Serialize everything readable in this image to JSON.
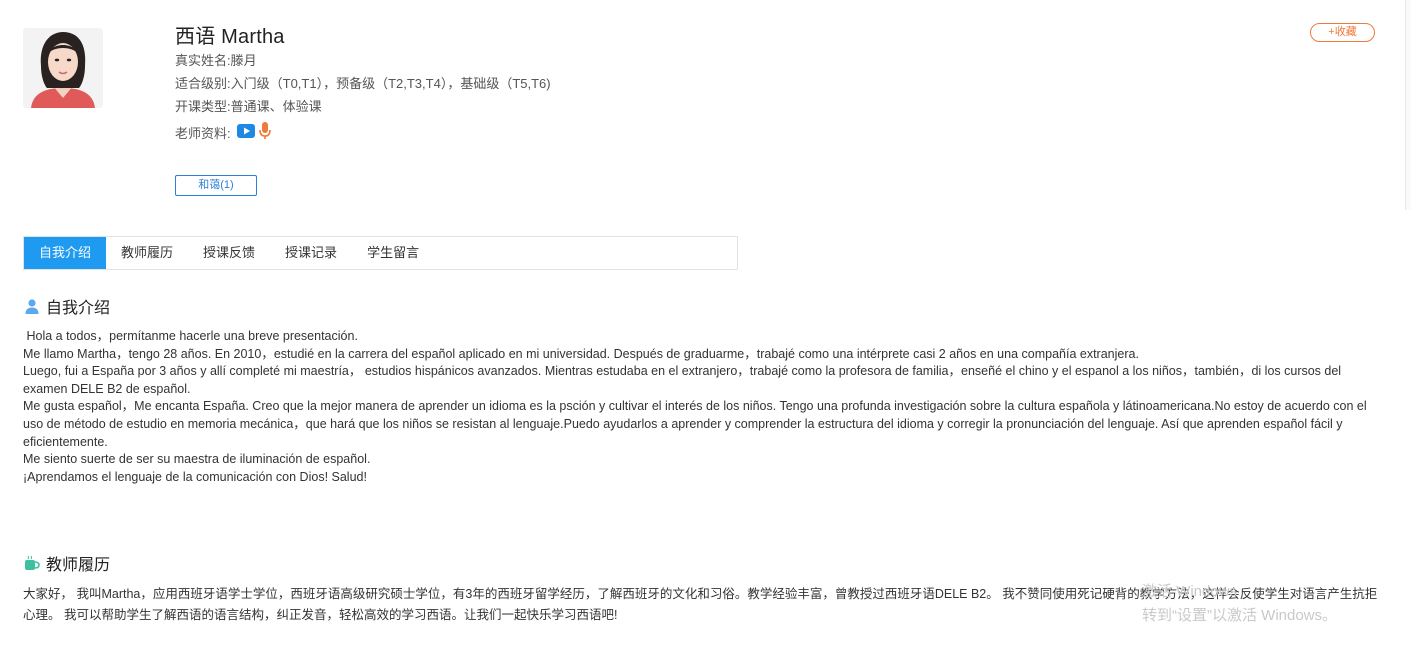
{
  "profile": {
    "name": "西语 Martha",
    "real_name_label": "真实姓名:",
    "real_name": "滕月",
    "level_label": "适合级别:",
    "levels": "入门级（T0,T1），预备级（T2,T3,T4），基础级（T5,T6)",
    "course_type_label": "开课类型:",
    "course_types": "普通课、体验课",
    "materials_label": "老师资料:",
    "material_icons": [
      "video-icon",
      "microphone-icon"
    ],
    "favorite_label": "+收藏",
    "tag_label": "和蔼(1)"
  },
  "tabs": [
    {
      "label": "自我介绍",
      "active": true
    },
    {
      "label": "教师履历",
      "active": false
    },
    {
      "label": "授课反馈",
      "active": false
    },
    {
      "label": "授课记录",
      "active": false
    },
    {
      "label": "学生留言",
      "active": false
    }
  ],
  "intro": {
    "title": "自我介绍",
    "icon": "user-icon",
    "paragraphs": [
      " Hola a todos，permítanme hacerle una breve presentación.",
      "Me llamo Martha，tengo 28 años. En 2010，estudié en la carrera del español aplicado en mi universidad. Después de graduarme，trabajé como una intérprete casi 2 años en una compañía extranjera.",
      "Luego, fui a España por 3 años y allí completé mi maestría， estudios hispánicos avanzados. Mientras estudaba en el extranjero，trabajé como la profesora de familia，enseñé el chino y el espanol a los niños，también，di los cursos del examen DELE B2 de español.",
      "Me gusta español，Me encanta España.  Creo que la mejor manera de aprender un idioma es la psción y cultivar el interés de los niños. Tengo una profunda investigación sobre la cultura española y látinoamericana.No estoy de acuerdo con el uso de método de estudio en memoria mecánica，que hará que los niños se resistan al lenguaje.Puedo ayudarlos a aprender y comprender la estructura del idioma y corregir la pronunciación del lenguaje. Así que aprenden español fácil y eficientemente.",
      "Me siento suerte de ser su maestra de iluminación de español.",
      "¡Aprendamos el lenguaje de la comunicación con Dios! Salud!"
    ]
  },
  "resume": {
    "title": "教师履历",
    "icon": "coffee-cup-icon",
    "text": " 大家好， 我叫Martha，应用西班牙语学士学位，西班牙语高级研究硕士学位，有3年的西班牙留学经历，了解西班牙的文化和习俗。教学经验丰富，曾教授过西班牙语DELE B2。 我不赞同使用死记硬背的教学方法，这样会反使学生对语言产生抗拒心理。 我可以帮助学生了解西语的语言结构，纠正发音，轻松高效的学习西语。让我们一起快乐学习西语吧!"
  },
  "watermark": {
    "line1": "激活 Windows",
    "line2": "转到“设置”以激活 Windows。"
  }
}
